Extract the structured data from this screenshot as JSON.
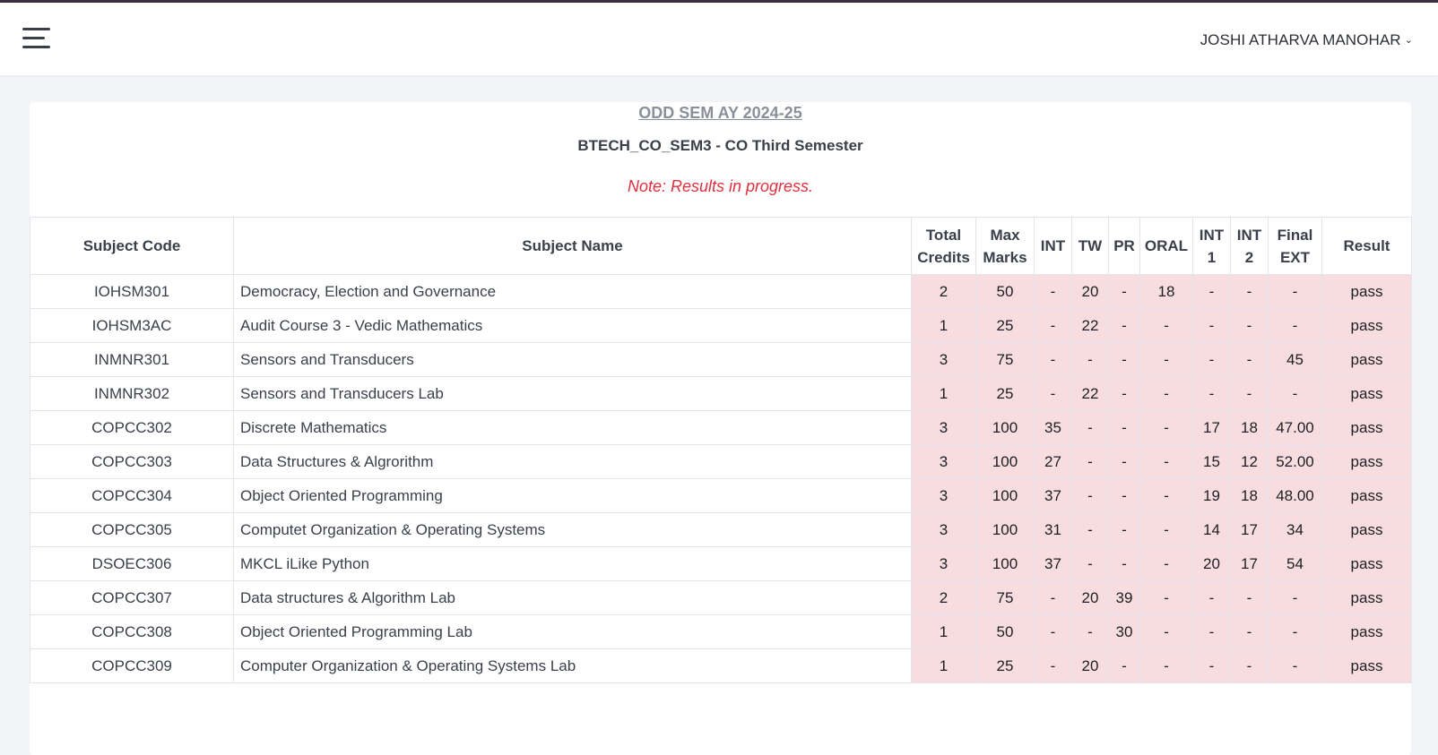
{
  "header": {
    "user_name": "JOSHI ATHARVA MANOHAR"
  },
  "result": {
    "semester_title": "ODD SEM AY 2024-25",
    "program_title": "BTECH_CO_SEM3 - CO Third Semester",
    "note": "Note: Results in progress."
  },
  "table": {
    "headers": {
      "subject_code": "Subject Code",
      "subject_name": "Subject Name",
      "total_credits_1": "Total",
      "total_credits_2": "Credits",
      "max_marks_1": "Max",
      "max_marks_2": "Marks",
      "int": "INT",
      "tw": "TW",
      "pr": "PR",
      "oral": "ORAL",
      "int1_1": "INT",
      "int1_2": "1",
      "int2_1": "INT",
      "int2_2": "2",
      "final_ext_1": "Final",
      "final_ext_2": "EXT",
      "result": "Result"
    },
    "rows": [
      {
        "code": "IOHSM301",
        "name": "Democracy, Election and Governance",
        "credits": "2",
        "max": "50",
        "int": "-",
        "tw": "20",
        "pr": "-",
        "oral": "18",
        "int1": "-",
        "int2": "-",
        "ext": "-",
        "result": "pass"
      },
      {
        "code": "IOHSM3AC",
        "name": "Audit Course 3 - Vedic Mathematics",
        "credits": "1",
        "max": "25",
        "int": "-",
        "tw": "22",
        "pr": "-",
        "oral": "-",
        "int1": "-",
        "int2": "-",
        "ext": "-",
        "result": "pass"
      },
      {
        "code": "INMNR301",
        "name": "Sensors and Transducers",
        "credits": "3",
        "max": "75",
        "int": "-",
        "tw": "-",
        "pr": "-",
        "oral": "-",
        "int1": "-",
        "int2": "-",
        "ext": "45",
        "result": "pass"
      },
      {
        "code": "INMNR302",
        "name": "Sensors and Transducers Lab",
        "credits": "1",
        "max": "25",
        "int": "-",
        "tw": "22",
        "pr": "-",
        "oral": "-",
        "int1": "-",
        "int2": "-",
        "ext": "-",
        "result": "pass"
      },
      {
        "code": "COPCC302",
        "name": "Discrete Mathematics",
        "credits": "3",
        "max": "100",
        "int": "35",
        "tw": "-",
        "pr": "-",
        "oral": "-",
        "int1": "17",
        "int2": "18",
        "ext": "47.00",
        "result": "pass"
      },
      {
        "code": "COPCC303",
        "name": "Data Structures & Algrorithm",
        "credits": "3",
        "max": "100",
        "int": "27",
        "tw": "-",
        "pr": "-",
        "oral": "-",
        "int1": "15",
        "int2": "12",
        "ext": "52.00",
        "result": "pass"
      },
      {
        "code": "COPCC304",
        "name": "Object Oriented Programming",
        "credits": "3",
        "max": "100",
        "int": "37",
        "tw": "-",
        "pr": "-",
        "oral": "-",
        "int1": "19",
        "int2": "18",
        "ext": "48.00",
        "result": "pass"
      },
      {
        "code": "COPCC305",
        "name": "Computet Organization & Operating Systems",
        "credits": "3",
        "max": "100",
        "int": "31",
        "tw": "-",
        "pr": "-",
        "oral": "-",
        "int1": "14",
        "int2": "17",
        "ext": "34",
        "result": "pass"
      },
      {
        "code": "DSOEC306",
        "name": "MKCL iLike Python",
        "credits": "3",
        "max": "100",
        "int": "37",
        "tw": "-",
        "pr": "-",
        "oral": "-",
        "int1": "20",
        "int2": "17",
        "ext": "54",
        "result": "pass"
      },
      {
        "code": "COPCC307",
        "name": "Data structures & Algorithm Lab",
        "credits": "2",
        "max": "75",
        "int": "-",
        "tw": "20",
        "pr": "39",
        "oral": "-",
        "int1": "-",
        "int2": "-",
        "ext": "-",
        "result": "pass"
      },
      {
        "code": "COPCC308",
        "name": "Object Oriented Programming Lab",
        "credits": "1",
        "max": "50",
        "int": "-",
        "tw": "-",
        "pr": "30",
        "oral": "-",
        "int1": "-",
        "int2": "-",
        "ext": "-",
        "result": "pass"
      },
      {
        "code": "COPCC309",
        "name": "Computer Organization & Operating Systems Lab",
        "credits": "1",
        "max": "25",
        "int": "-",
        "tw": "20",
        "pr": "-",
        "oral": "-",
        "int1": "-",
        "int2": "-",
        "ext": "-",
        "result": "pass"
      }
    ]
  }
}
